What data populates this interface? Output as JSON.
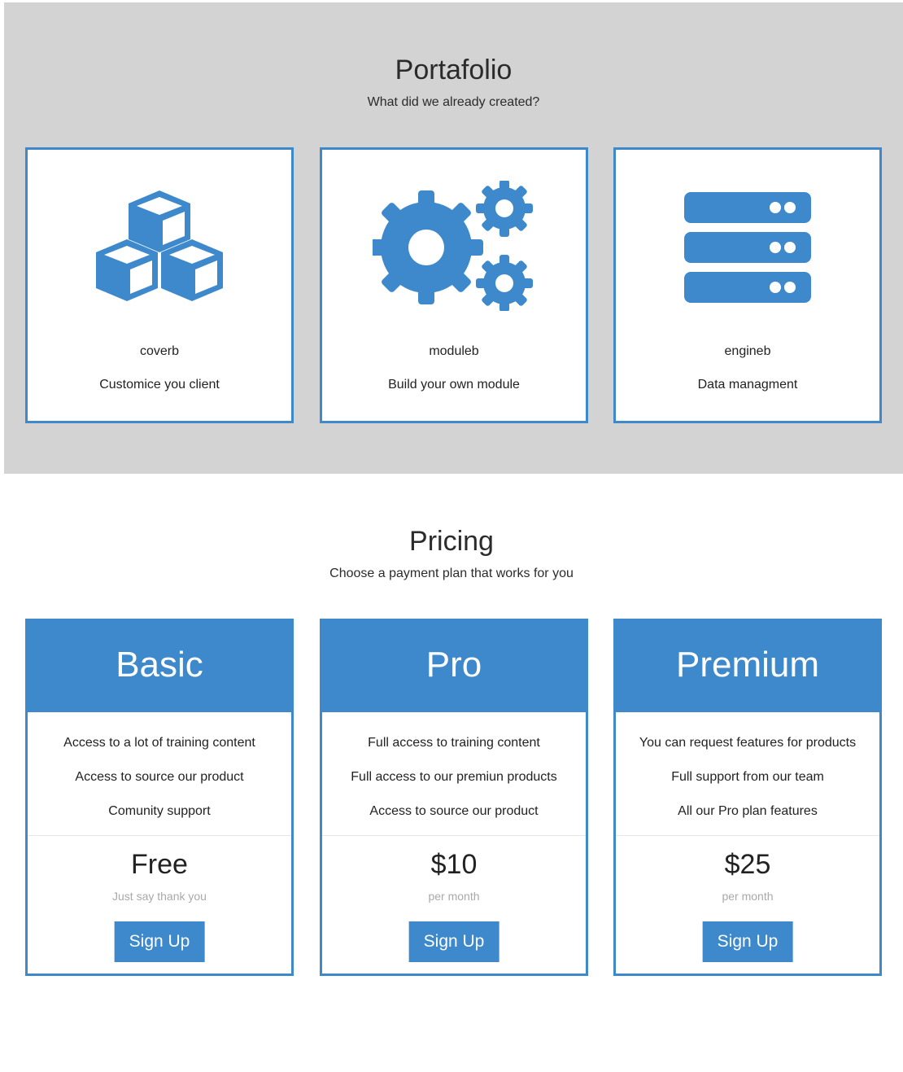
{
  "portfolio": {
    "title": "Portafolio",
    "subtitle": "What did we already created?",
    "items": [
      {
        "icon": "cubes-icon",
        "name": "coverb",
        "description": "Customice you client"
      },
      {
        "icon": "cogs-icon",
        "name": "moduleb",
        "description": "Build your own module"
      },
      {
        "icon": "server-icon",
        "name": "engineb",
        "description": "Data managment"
      }
    ]
  },
  "pricing": {
    "title": "Pricing",
    "subtitle": "Choose a payment plan that works for you",
    "plans": [
      {
        "name": "Basic",
        "features": [
          "Access to a lot of training content",
          "Access to source our product",
          "Comunity support"
        ],
        "price": "Free",
        "period": "Just say thank you",
        "button": "Sign Up"
      },
      {
        "name": "Pro",
        "features": [
          "Full access to training content",
          "Full access to our premiun products",
          "Access to source our product"
        ],
        "price": "$10",
        "period": "per month",
        "button": "Sign Up"
      },
      {
        "name": "Premium",
        "features": [
          "You can request features for products",
          "Full support from our team",
          "All our Pro plan features"
        ],
        "price": "$25",
        "period": "per month",
        "button": "Sign Up"
      }
    ]
  },
  "colors": {
    "accent": "#3d89cc",
    "portfolio_bg": "#d3d3d3",
    "muted_text": "#a9a9a9"
  }
}
